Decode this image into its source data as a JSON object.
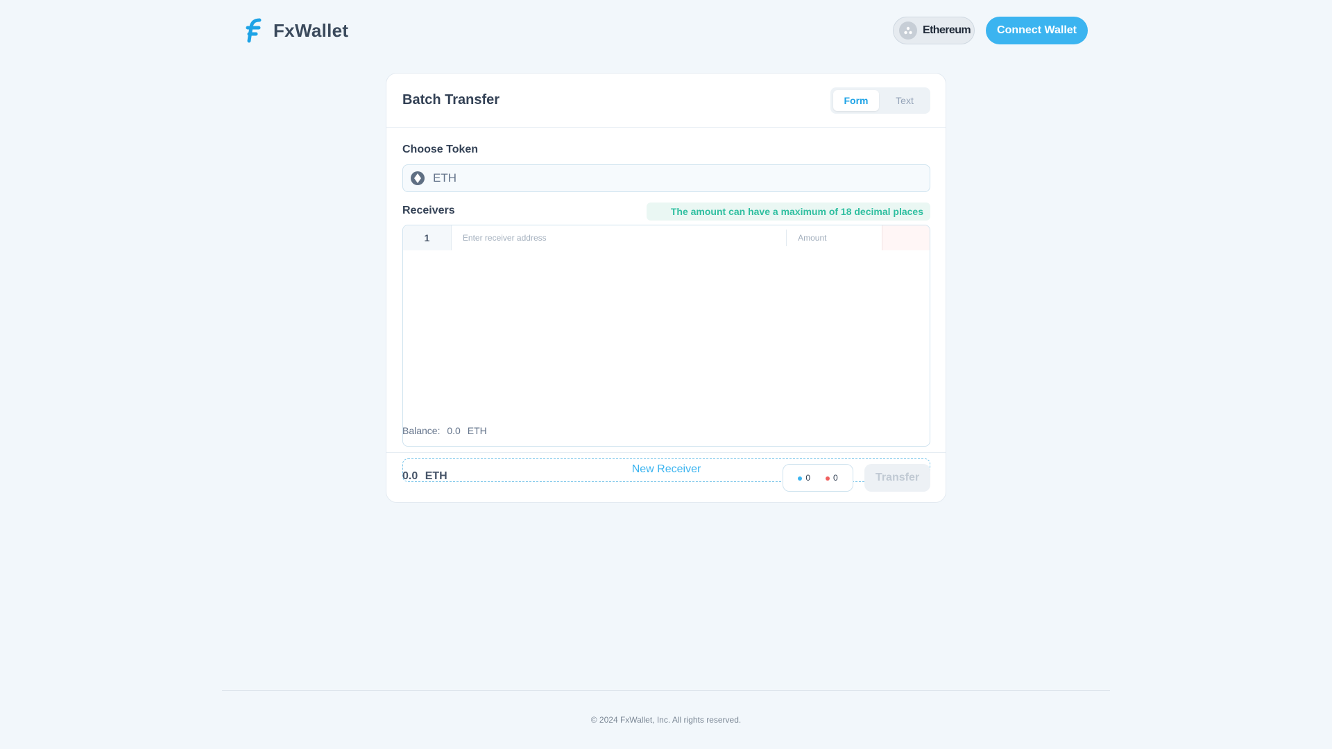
{
  "header": {
    "brand": "FxWallet",
    "network": "Ethereum",
    "connect_label": "Connect Wallet"
  },
  "card": {
    "title": "Batch Transfer",
    "tabs": [
      {
        "label": "Form",
        "active": true
      },
      {
        "label": "Text",
        "active": false
      }
    ],
    "token_label": "Choose Token",
    "token_value": "ETH",
    "receivers_label": "Receivers",
    "hint": "The amount can have a maximum of 18 decimal places",
    "rows": [
      {
        "index": "1",
        "address_placeholder": "Enter receiver address",
        "amount_placeholder": "Amount"
      }
    ],
    "balance": {
      "label": "Balance:",
      "value": "0.0",
      "unit": "ETH"
    },
    "new_receiver_label": "New Receiver",
    "total": {
      "value": "0.0",
      "unit": "ETH"
    },
    "counts": {
      "valid": "0",
      "invalid": "0"
    },
    "transfer_label": "Transfer"
  },
  "footer": {
    "copyright": "© 2024 FxWallet, Inc. All rights reserved."
  },
  "colors": {
    "accent": "#3bb4f0",
    "hint_text": "#2fbfa0",
    "error_dot": "#f0605f",
    "background": "#f2f7fb"
  },
  "icons": [
    "fxwallet-logo-icon",
    "ethereum-network-icon",
    "eth-token-icon"
  ]
}
